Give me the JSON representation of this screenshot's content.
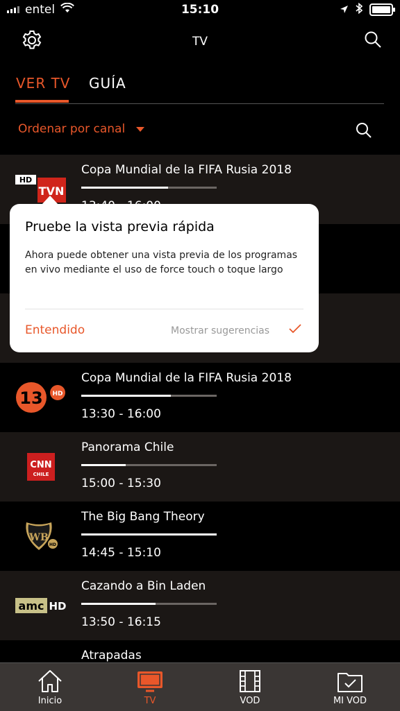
{
  "status_bar": {
    "carrier": "entel",
    "time": "15:10"
  },
  "nav": {
    "title": "TV"
  },
  "tabs": [
    {
      "label": "VER TV",
      "active": true
    },
    {
      "label": "GUÍA",
      "active": false
    }
  ],
  "sort": {
    "label": "Ordenar por canal"
  },
  "channels": [
    {
      "logo": "tvn-hd",
      "title": "Copa Mundial de la FIFA Rusia 2018",
      "time": "13:40 - 16:00",
      "progress": 0.64
    },
    {
      "logo": "canal-13-hd",
      "title": "Copa Mundial de la FIFA Rusia 2018",
      "time": "13:30 - 16:00",
      "progress": 0.66
    },
    {
      "logo": "cnn-chile",
      "title": "Panorama Chile",
      "time": "15:00 - 15:30",
      "progress": 0.33
    },
    {
      "logo": "warner-bros-hd",
      "title": "The Big Bang Theory",
      "time": "14:45 - 15:10",
      "progress": 1.0
    },
    {
      "logo": "amc-hd",
      "title": "Cazando a Bin Laden",
      "time": "13:50 - 16:15",
      "progress": 0.55
    },
    {
      "logo": "",
      "title": "Atrapadas",
      "time": "",
      "progress": 0
    }
  ],
  "logos": {
    "tvn_hd": "HD",
    "tvn": "TVN",
    "c13": "13",
    "c13_hd": "HD",
    "cnn": "CNN",
    "cnn_sub": "CHILE",
    "wb": "WB",
    "wb_hd": "HD",
    "amc": "amc",
    "amc_hd": "HD"
  },
  "popup": {
    "title": "Pruebe la vista previa rápida",
    "body": "Ahora puede obtener una vista previa de los programas en vivo mediante el uso de force touch o toque largo",
    "confirm": "Entendido",
    "show_tips": "Mostrar sugerencias"
  },
  "tabbar": [
    {
      "label": "Inicio",
      "icon": "home-icon",
      "active": false
    },
    {
      "label": "TV",
      "icon": "tv-icon",
      "active": true
    },
    {
      "label": "VOD",
      "icon": "film-icon",
      "active": false
    },
    {
      "label": "MI VOD",
      "icon": "folder-check-icon",
      "active": false
    }
  ],
  "colors": {
    "accent": "#e8572a",
    "row_alt": "#1b1715",
    "tabbar": "#3a3634"
  }
}
